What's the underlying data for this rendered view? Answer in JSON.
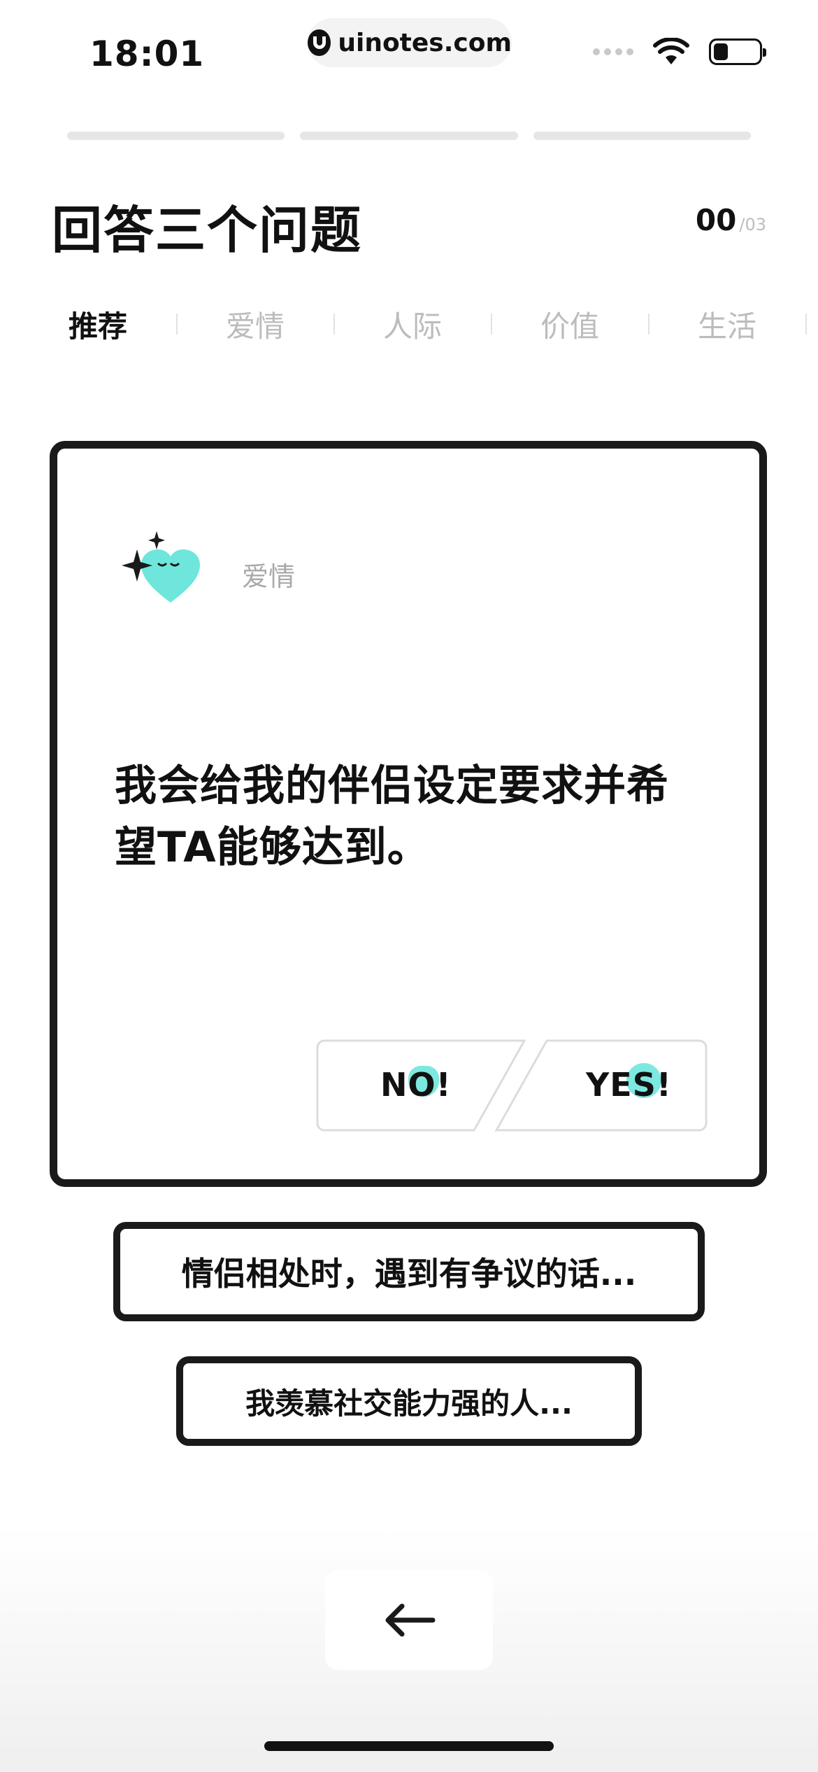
{
  "status_bar": {
    "time": "18:01",
    "url": "uinotes.com",
    "icons": [
      "signal-icon",
      "wifi-icon",
      "battery-icon"
    ]
  },
  "progress": {
    "segments": 3,
    "completed": 0
  },
  "header": {
    "title": "回答三个问题",
    "counter_current": "00",
    "counter_total": "/03"
  },
  "tabs": [
    {
      "label": "推荐",
      "active": true
    },
    {
      "label": "爱情",
      "active": false
    },
    {
      "label": "人际",
      "active": false
    },
    {
      "label": "价值",
      "active": false
    },
    {
      "label": "生活",
      "active": false
    }
  ],
  "question_card": {
    "category_icon": "heart-sparkle-icon",
    "category": "爱情",
    "question": "我会给我的伴侣设定要求并希望TA能够达到。",
    "no_label": "NO!",
    "yes_label": "YES!"
  },
  "upcoming": [
    {
      "text": "情侣相处时，遇到有争议的话..."
    },
    {
      "text": "我羡慕社交能力强的人..."
    }
  ],
  "nav": {
    "back_icon": "arrow-left-icon"
  },
  "colors": {
    "accent": "#6fe6dc",
    "ink": "#1a1a1a",
    "muted": "#bcbcbc"
  }
}
